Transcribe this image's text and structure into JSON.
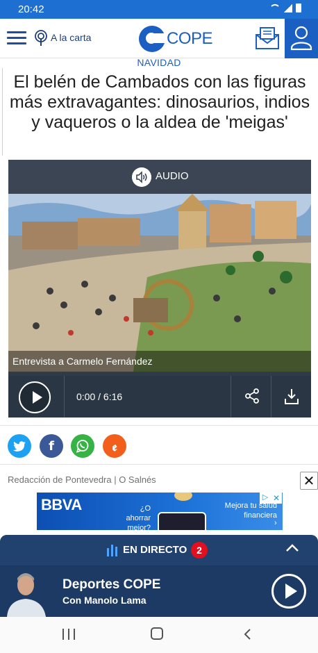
{
  "status_bar": {
    "time": "20:42"
  },
  "header": {
    "alacarta_label": "A la carta",
    "logo_text": "COPE"
  },
  "article": {
    "section": "NAVIDAD",
    "title": "El belén de Cambados con las figuras más extravagantes: dinosaurios, indios y vaqueros o la aldea de 'meigas'",
    "author": "Redacción de Pontevedra | O Salnés"
  },
  "audio": {
    "label": "AUDIO",
    "caption": "Entrevista a Carmelo Fernández",
    "time": "0:00 / 6:16"
  },
  "ad": {
    "brand": "BBVA",
    "text1": "¿O ahorrar mejor?",
    "text2": "Mejora tu salud financiera"
  },
  "live": {
    "label": "EN DIRECTO",
    "count": "2",
    "show_name": "Deportes COPE",
    "show_host": "Con Manolo Lama"
  },
  "colors": {
    "brand_blue": "#1b5fc2",
    "status_bar": "#1d6fd1",
    "live_panel": "#1e3c66",
    "live_badge": "#e10f1f"
  }
}
